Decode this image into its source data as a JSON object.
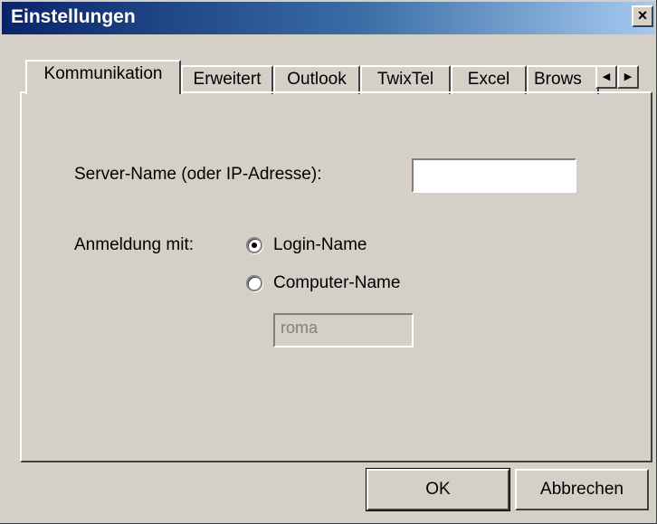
{
  "window": {
    "title": "Einstellungen",
    "close_glyph": "×"
  },
  "tabs": [
    {
      "label": "Kommunikation",
      "active": true
    },
    {
      "label": "Erweitert",
      "active": false
    },
    {
      "label": "Outlook",
      "active": false
    },
    {
      "label": "TwixTel",
      "active": false
    },
    {
      "label": "Excel",
      "active": false
    },
    {
      "label": "Brows",
      "active": false
    }
  ],
  "tab_scroll": {
    "left_icon": "◀",
    "right_icon": "▶"
  },
  "form": {
    "server_label": "Server-Name (oder IP-Adresse):",
    "server_value": "",
    "login_label": "Anmeldung mit:",
    "radio_login_name": "Login-Name",
    "radio_computer_name": "Computer-Name",
    "selected": "login-name",
    "computer_name_value": "roma"
  },
  "buttons": {
    "ok": "OK",
    "cancel": "Abbrechen"
  }
}
